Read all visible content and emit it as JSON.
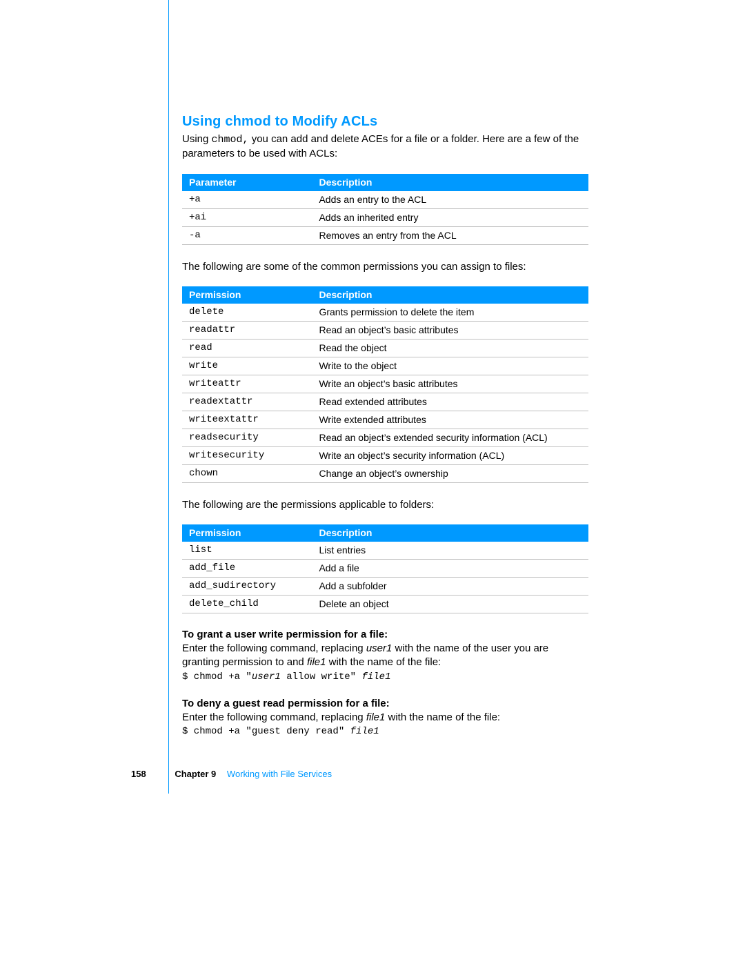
{
  "section_title": "Using chmod to Modify ACLs",
  "intro": {
    "pre": "Using ",
    "code": "chmod,",
    "post": " you can add and delete ACEs for a file or a folder. Here are a few of the parameters to be used with ACLs:"
  },
  "tables": {
    "params": {
      "head": [
        "Parameter",
        "Description"
      ],
      "rows": [
        {
          "p": "+a",
          "d": "Adds an entry to the ACL"
        },
        {
          "p": "+ai",
          "d": "Adds an inherited entry"
        },
        {
          "p": "-a",
          "d": "Removes an entry from the ACL"
        }
      ]
    },
    "file_perms": {
      "intro": "The following are some of the common permissions you can assign to files:",
      "head": [
        "Permission",
        "Description"
      ],
      "rows": [
        {
          "p": "delete",
          "d": "Grants permission to delete the item"
        },
        {
          "p": "readattr",
          "d": "Read an object’s basic attributes"
        },
        {
          "p": "read",
          "d": "Read the object"
        },
        {
          "p": "write",
          "d": "Write to the object"
        },
        {
          "p": "writeattr",
          "d": "Write an object’s basic attributes"
        },
        {
          "p": "readextattr",
          "d": "Read extended attributes"
        },
        {
          "p": "writeextattr",
          "d": "Write extended attributes"
        },
        {
          "p": "readsecurity",
          "d": "Read an object’s extended security information (ACL)"
        },
        {
          "p": "writesecurity",
          "d": "Write an object’s security information (ACL)"
        },
        {
          "p": "chown",
          "d": "Change an object’s ownership"
        }
      ]
    },
    "folder_perms": {
      "intro": "The following are the permissions applicable to folders:",
      "head": [
        "Permission",
        "Description"
      ],
      "rows": [
        {
          "p": "list",
          "d": "List entries"
        },
        {
          "p": "add_file",
          "d": "Add a file"
        },
        {
          "p": "add_sudirectory",
          "d": "Add a subfolder"
        },
        {
          "p": "delete_child",
          "d": "Delete an object"
        }
      ]
    }
  },
  "howto": {
    "grant": {
      "title": "To grant a user write permission for a file:",
      "body_pre": "Enter the following command, replacing ",
      "body_it1": "user1",
      "body_mid": " with the name of the user you are granting permission to and ",
      "body_it2": "file1",
      "body_post": " with the name of the file:",
      "cmd_pre": "$ chmod +a \"",
      "cmd_it1": "user1",
      "cmd_mid": " allow write\" ",
      "cmd_it2": "file1"
    },
    "deny": {
      "title": "To deny a guest read permission for a file:",
      "body_pre": "Enter the following command, replacing ",
      "body_it1": "file1",
      "body_post": " with the name of the file:",
      "cmd_pre": "$ chmod +a \"guest deny read\" ",
      "cmd_it1": "file1"
    }
  },
  "footer": {
    "page": "158",
    "chapter_label": "Chapter 9",
    "chapter_title": "Working with File Services"
  }
}
